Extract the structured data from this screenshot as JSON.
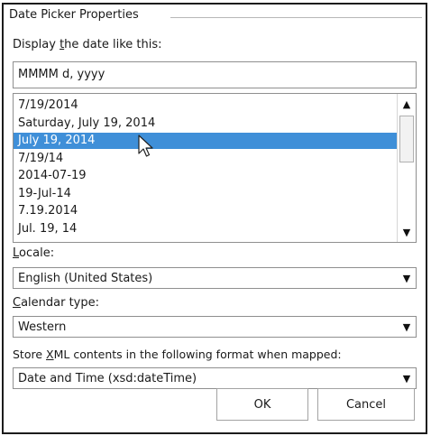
{
  "dialog": {
    "group_title": "Date Picker Properties",
    "display_label": {
      "before": "Display ",
      "key": "t",
      "after": "he date like this:"
    },
    "format_value": "MMMM d, yyyy",
    "formats": [
      "7/19/2014",
      "Saturday, July 19, 2014",
      "July 19, 2014",
      "7/19/14",
      "2014-07-19",
      "19-Jul-14",
      "7.19.2014",
      "Jul. 19, 14"
    ],
    "selected_index": 2,
    "locale_label": {
      "key": "L",
      "after": "ocale:"
    },
    "locale_value": "English (United States)",
    "calendar_label": {
      "key": "C",
      "after": "alendar type:"
    },
    "calendar_value": "Western",
    "store_label": {
      "before": "Store ",
      "key": "X",
      "after": "ML contents in the following format when mapped:"
    },
    "store_value": "Date and Time (xsd:dateTime)",
    "ok_label": "OK",
    "cancel_label": "Cancel"
  },
  "icons": {
    "scroll_up": "scroll-up-arrow-icon",
    "scroll_down": "scroll-down-arrow-icon",
    "dropdown": "dropdown-arrow-icon",
    "cursor": "mouse-pointer-icon"
  },
  "colors": {
    "selection": "#3f8fd8",
    "selection_text": "#ffffff",
    "border": "#8f8f8f"
  }
}
